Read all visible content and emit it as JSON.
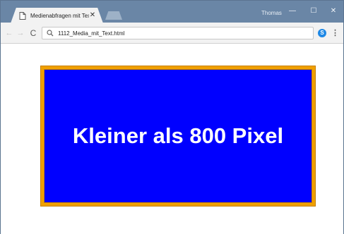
{
  "window": {
    "user_name": "Thomas",
    "minimize_glyph": "—",
    "maximize_glyph": "☐",
    "close_glyph": "✕"
  },
  "tab": {
    "title": "Medienabfragen mit Text",
    "close_glyph": "✕",
    "icon": "page-icon"
  },
  "toolbar": {
    "back_glyph": "←",
    "forward_glyph": "→",
    "reload_glyph": "C",
    "url": "1112_Media_mit_Text.html",
    "extension_label": "S",
    "menu_glyph": "⋮"
  },
  "page": {
    "media_text": "Kleiner als 800 Pixel",
    "colors": {
      "box_background": "#0000ff",
      "box_border": "#f0a000",
      "text": "#ffffff"
    }
  }
}
